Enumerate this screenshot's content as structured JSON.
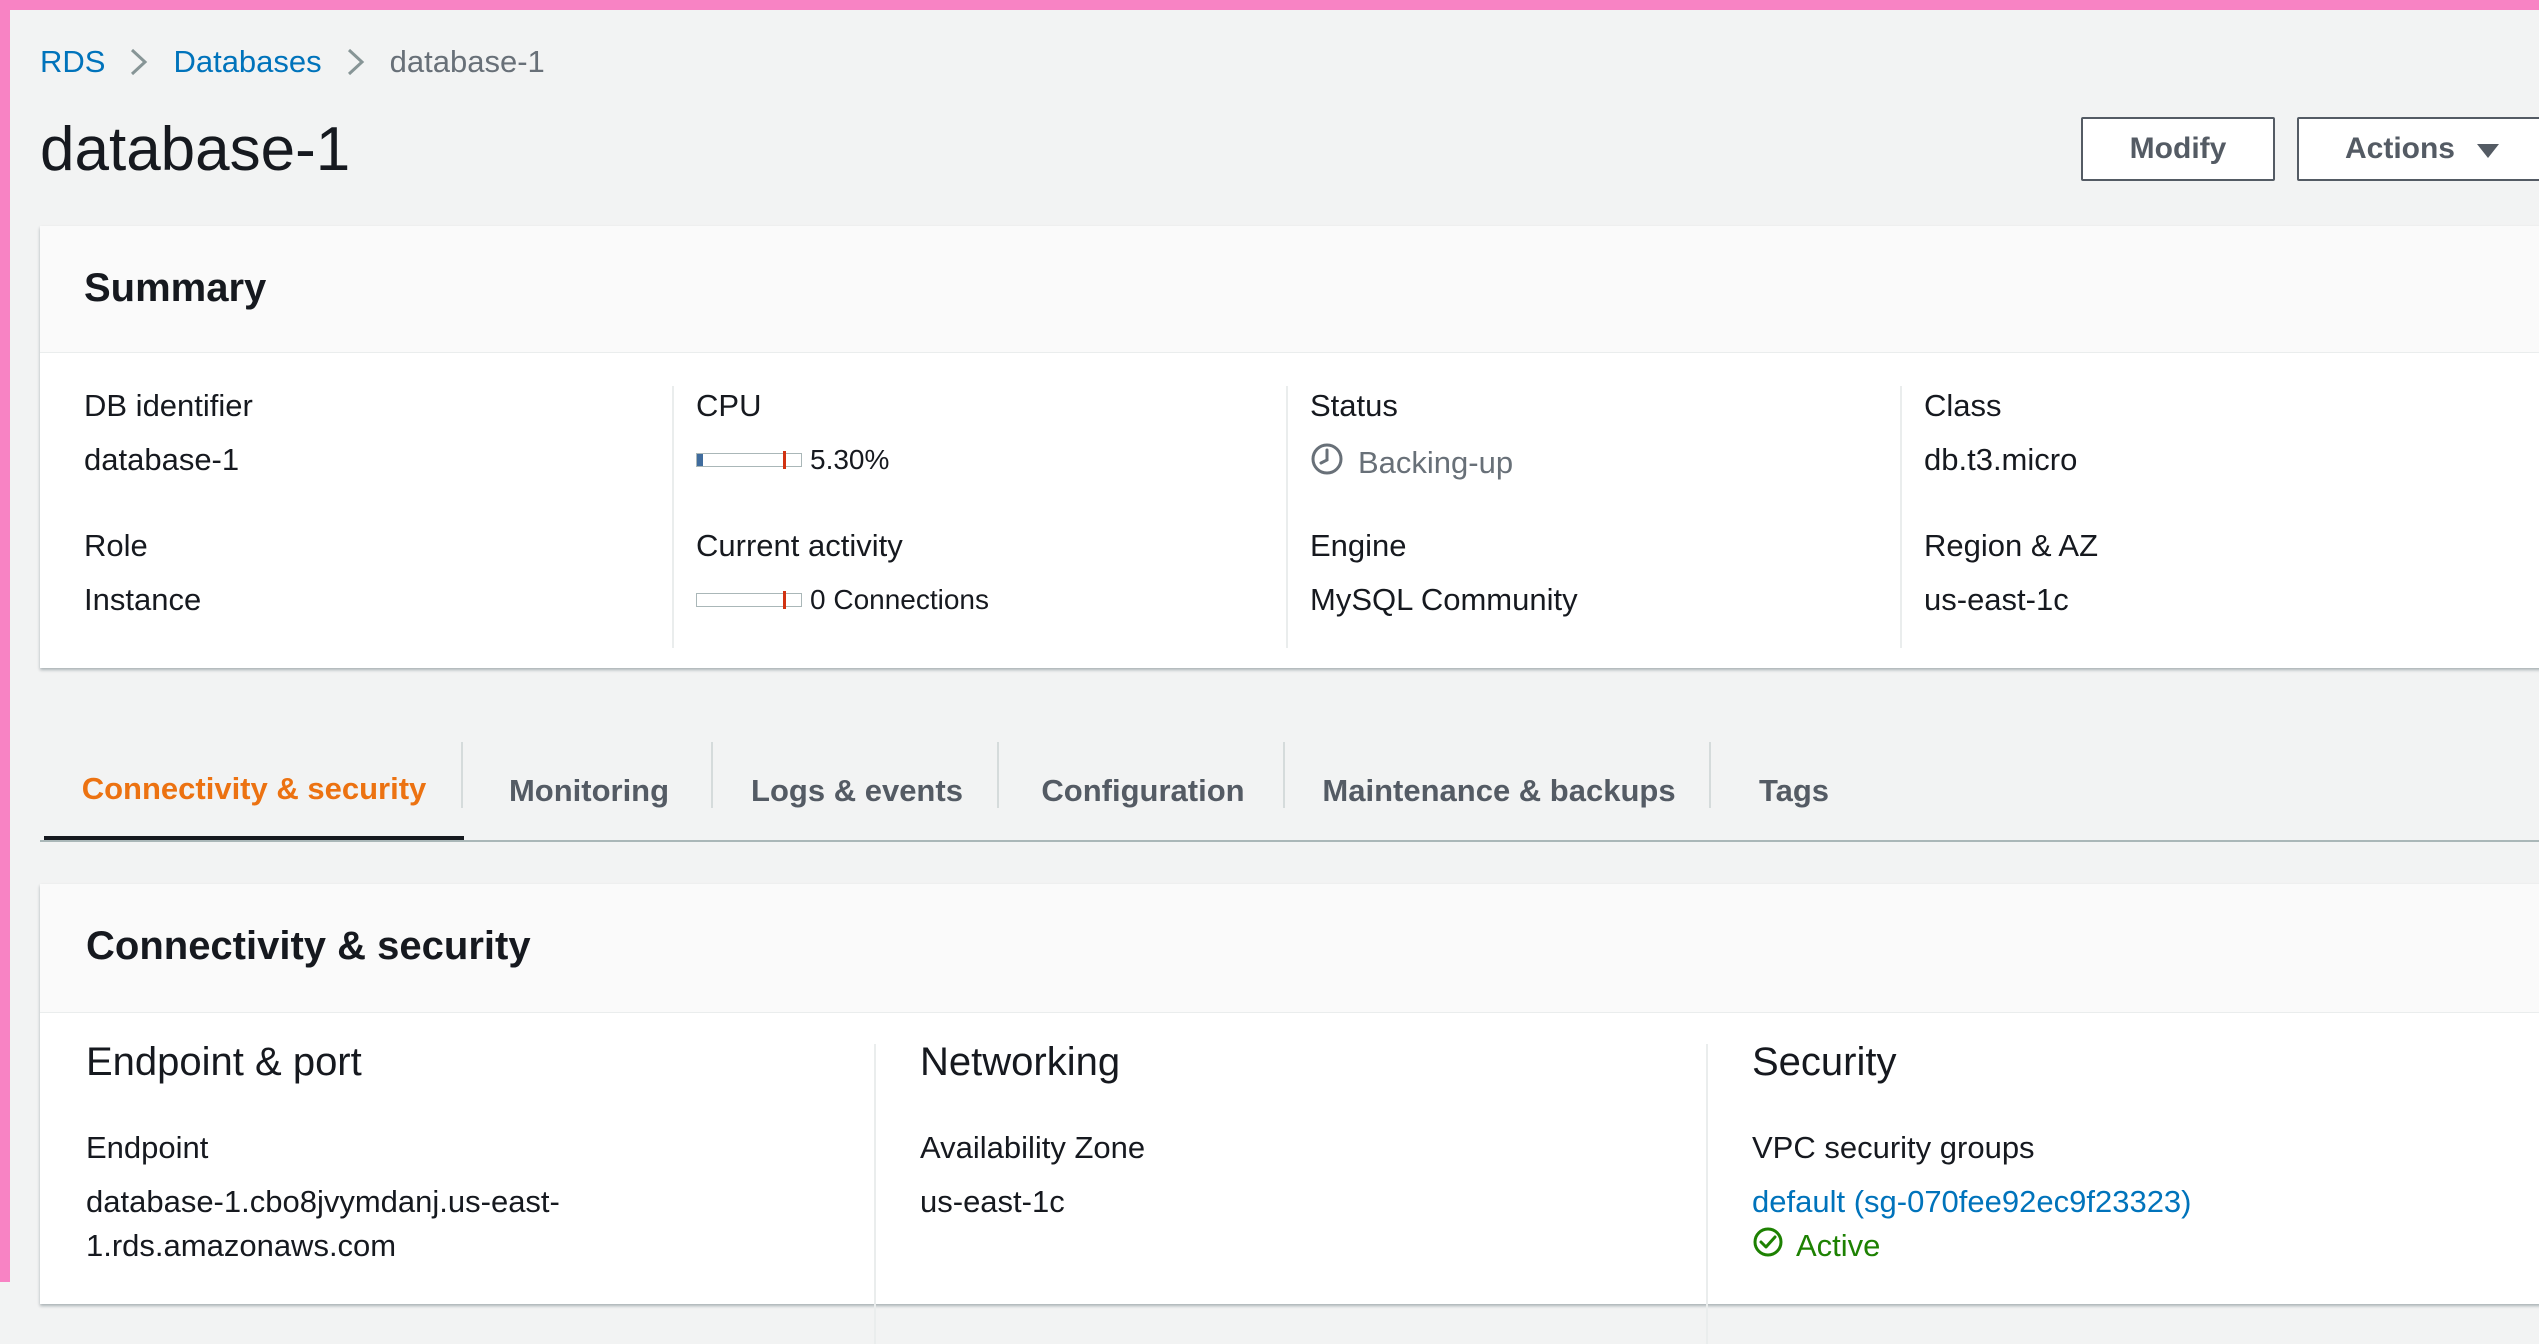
{
  "breadcrumb": {
    "items": [
      "RDS",
      "Databases"
    ],
    "current": "database-1"
  },
  "page_title": "database-1",
  "header_buttons": {
    "modify": "Modify",
    "actions": "Actions"
  },
  "summary": {
    "title": "Summary",
    "db_identifier": {
      "label": "DB identifier",
      "value": "database-1"
    },
    "role": {
      "label": "Role",
      "value": "Instance"
    },
    "cpu": {
      "label": "CPU",
      "value": "5.30%",
      "fill_fraction": 0.053
    },
    "current_activity": {
      "label": "Current activity",
      "value": "0 Connections",
      "fill_fraction": 0.0
    },
    "status": {
      "label": "Status",
      "value": "Backing-up",
      "icon": "clock-icon"
    },
    "engine": {
      "label": "Engine",
      "value": "MySQL Community"
    },
    "class": {
      "label": "Class",
      "value": "db.t3.micro"
    },
    "region_az": {
      "label": "Region & AZ",
      "value": "us-east-1c"
    }
  },
  "tabs": [
    {
      "label": "Connectivity & security",
      "active": true
    },
    {
      "label": "Monitoring",
      "active": false
    },
    {
      "label": "Logs & events",
      "active": false
    },
    {
      "label": "Configuration",
      "active": false
    },
    {
      "label": "Maintenance & backups",
      "active": false
    },
    {
      "label": "Tags",
      "active": false
    }
  ],
  "connectivity": {
    "title": "Connectivity & security",
    "endpoint_port": {
      "title": "Endpoint & port",
      "endpoint_label": "Endpoint",
      "endpoint_line1": "database-1.cbo8jvymdanj.us-east-",
      "endpoint_line2": "1.rds.amazonaws.com"
    },
    "networking": {
      "title": "Networking",
      "az_label": "Availability Zone",
      "az_value": "us-east-1c"
    },
    "security": {
      "title": "Security",
      "vpc_sg_label": "VPC security groups",
      "vpc_sg_value": "default (sg-070fee92ec9f23323)",
      "vpc_sg_status": "Active"
    }
  },
  "colors": {
    "link": "#0073bb",
    "accent_tab": "#ec7211",
    "success": "#1d8102",
    "frame": "#f883c4"
  }
}
